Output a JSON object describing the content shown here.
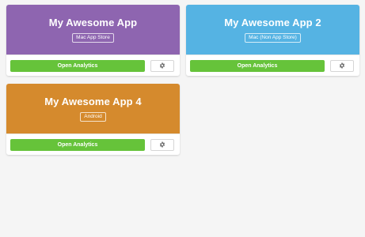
{
  "apps": [
    {
      "name": "My Awesome App",
      "platform": "Mac App Store",
      "color": "#8e65b0",
      "button_label": "Open Analytics",
      "settings_icon": "gear-icon"
    },
    {
      "name": "My Awesome App 2",
      "platform": "Mac (Non App Store)",
      "color": "#55b3e3",
      "button_label": "Open Analytics",
      "settings_icon": "gear-icon"
    },
    {
      "name": "My Awesome App 4",
      "platform": "Android",
      "color": "#d58a2d",
      "button_label": "Open Analytics",
      "settings_icon": "gear-icon"
    }
  ],
  "colors": {
    "button_green": "#66c33a",
    "gear": "#6b6b6b"
  }
}
